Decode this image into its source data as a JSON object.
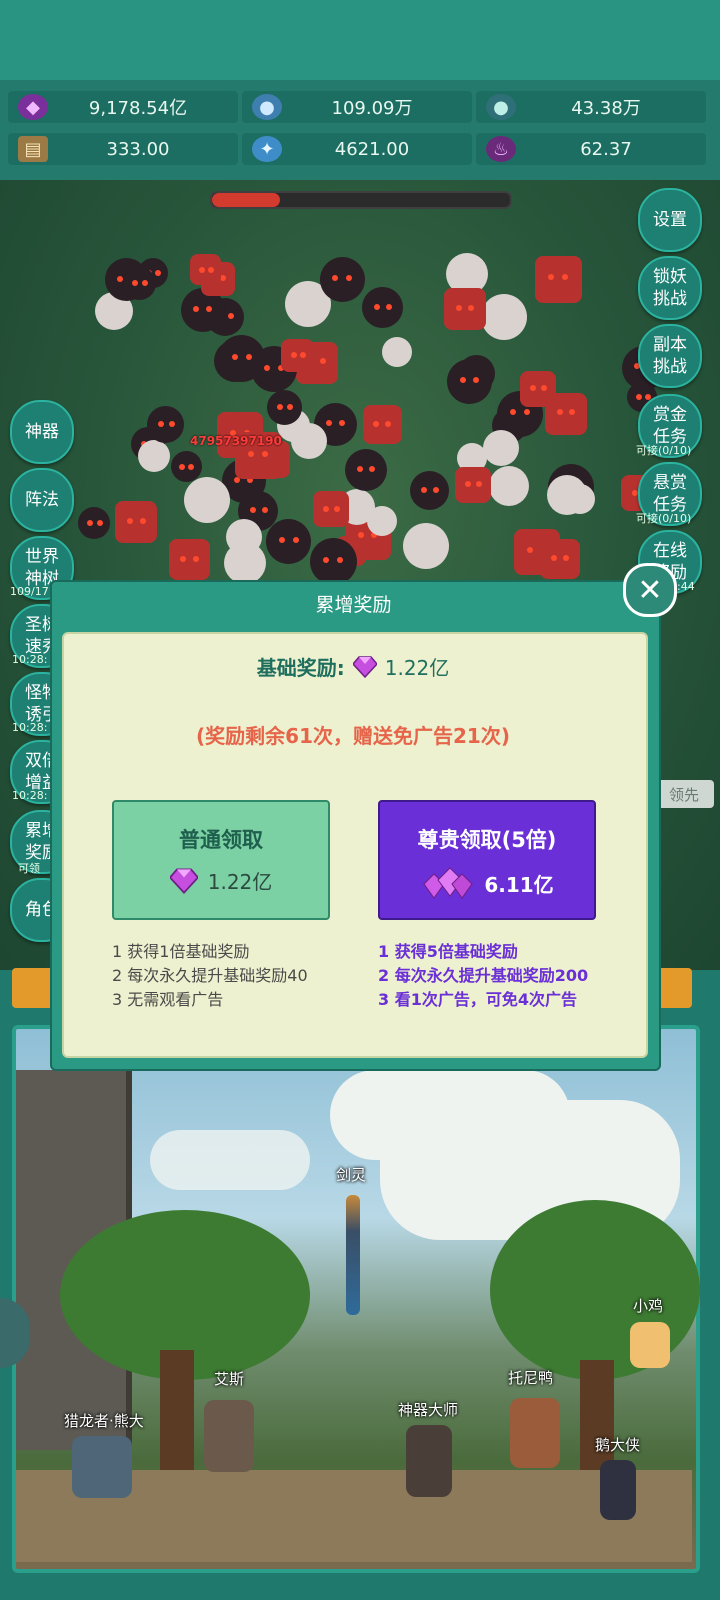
{
  "resources": [
    {
      "icon": "purple-gem-icon",
      "value": "9,178.54亿",
      "color": "#b04bd6"
    },
    {
      "icon": "blue-crystal-orb-icon",
      "value": "109.09万",
      "color": "#6fb4e6"
    },
    {
      "icon": "teal-orb-icon",
      "value": "43.38万",
      "color": "#4fa89a"
    },
    {
      "icon": "scroll-icon",
      "value": "333.00",
      "color": "#c9a56a"
    },
    {
      "icon": "ice-crystal-icon",
      "value": "4621.00",
      "color": "#7fc4f0"
    },
    {
      "icon": "purple-pot-icon",
      "value": "62.37",
      "color": "#8a3a9a"
    }
  ],
  "right_menu": [
    {
      "label": "设置",
      "sub": ""
    },
    {
      "label": "锁妖\n挑战",
      "sub": ""
    },
    {
      "label": "副本\n挑战",
      "sub": ""
    },
    {
      "label": "赏金\n任务",
      "sub": "可接(0/10)"
    },
    {
      "label": "悬赏\n任务",
      "sub": "可接(0/10)"
    },
    {
      "label": "在线\n奖励",
      "sub": "0:44"
    }
  ],
  "left_menu": [
    {
      "label": "神器",
      "sub": ""
    },
    {
      "label": "阵法",
      "sub": ""
    },
    {
      "label": "世界\n神树",
      "sub": "109/17"
    },
    {
      "label": "圣树\n速秀",
      "sub": "10:28:"
    },
    {
      "label": "怪物\n诱引",
      "sub": "10:28:"
    },
    {
      "label": "双倍\n增益",
      "sub": "10:28:"
    },
    {
      "label": "累增\n奖励",
      "sub": "可领"
    },
    {
      "label": "角色",
      "sub": ""
    }
  ],
  "battle": {
    "damage_text": "47957397190",
    "hp_fraction": 0.23
  },
  "modal": {
    "title": "累增奖励",
    "base_label": "基础奖励:",
    "base_value": "1.22亿",
    "remaining": "(奖励剩余61次，赠送免广告21次)",
    "normal": {
      "title": "普通领取",
      "amount": "1.22亿",
      "desc": [
        "1 获得1倍基础奖励",
        "2 每次永久提升基础奖励40",
        "3 无需观看广告"
      ]
    },
    "vip": {
      "title": "尊贵领取(5倍)",
      "amount": "6.11亿",
      "desc": [
        "1 获得5倍基础奖励",
        "2 每次永久提升基础奖励200",
        "3 看1次广告，可免4次广告"
      ]
    }
  },
  "scene_characters": [
    {
      "name": "剑灵"
    },
    {
      "name": "小鸡"
    },
    {
      "name": "艾斯"
    },
    {
      "name": "托尼鸭"
    },
    {
      "name": "猎龙者·熊大"
    },
    {
      "name": "神器大师"
    },
    {
      "name": "鹅大侠"
    }
  ],
  "side_tag": "领先"
}
